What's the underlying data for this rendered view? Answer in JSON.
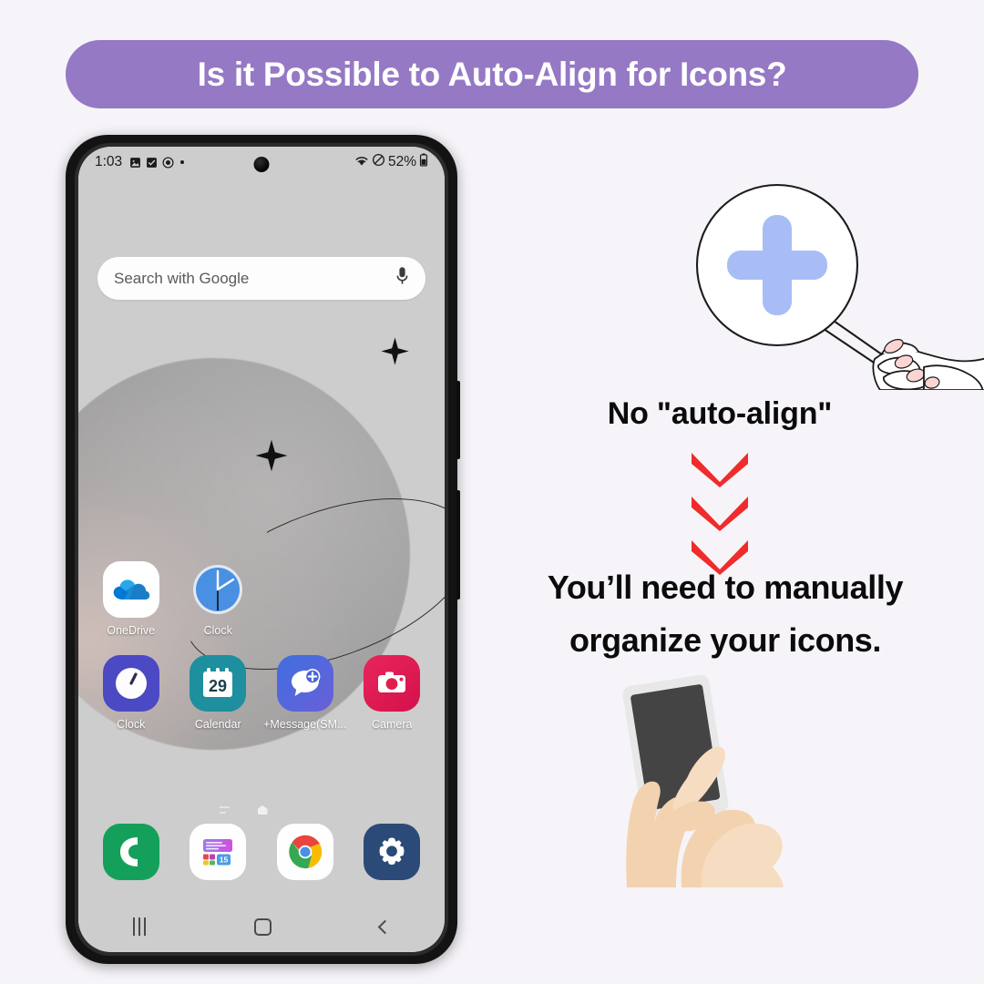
{
  "background_color": "#f6f4f8",
  "banner": {
    "title": "Is it Possible to Auto-Align for Icons?",
    "background_color": "#9579c4",
    "text_color": "#ffffff"
  },
  "phone": {
    "status_bar": {
      "time": "1:03",
      "left_icons": [
        "image-icon",
        "checkbox-icon",
        "capture-icon",
        "dot-icon"
      ],
      "right_icons": [
        "wifi-icon",
        "mute-icon"
      ],
      "battery_percent": "52%",
      "battery_icon": "battery-icon"
    },
    "search_bar": {
      "placeholder": "Search with Google",
      "mic_icon": "microphone-icon"
    },
    "wallpaper": {
      "description": "grey sphere with orbit ring",
      "sparkle_icons": [
        "sparkle-icon",
        "sparkle-icon"
      ]
    },
    "home_rows": [
      [
        {
          "label": "OneDrive",
          "icon": "onedrive-icon",
          "color": "#ffffff"
        },
        {
          "label": "Clock",
          "icon": "clock-icon",
          "color": "#4a90e2"
        }
      ],
      [
        {
          "label": "Clock",
          "icon": "clock-icon",
          "color": "#4b49c4"
        },
        {
          "label": "Calendar",
          "icon": "calendar-icon",
          "color": "#1d8f9e",
          "day": "29"
        },
        {
          "label": "+Message(SM...",
          "icon": "message-plus-icon",
          "color": "#4a63d8"
        },
        {
          "label": "Camera",
          "icon": "camera-icon",
          "color": "#e0204c"
        }
      ]
    ],
    "page_indicator": {
      "icons": [
        "menu-icon",
        "dot-icon",
        "home-page-icon",
        "dot-icon",
        "dot-icon"
      ],
      "active_index": 2,
      "total_pages": 4
    },
    "dock": [
      {
        "label": "",
        "icon": "phone-icon",
        "color": "#14a05a"
      },
      {
        "label": "",
        "icon": "widgets-icon",
        "color": "#ffffff",
        "badge": "15"
      },
      {
        "label": "",
        "icon": "chrome-icon",
        "color": "#ffffff"
      },
      {
        "label": "",
        "icon": "settings-gear-icon",
        "color": "#2c4a78"
      }
    ],
    "nav_bar": {
      "recents": "recents-icon",
      "home": "home-icon",
      "back": "back-icon"
    }
  },
  "right": {
    "magnifier_icon": "magnifier-plus-icon",
    "hand_icon": "hand-holding-magnifier-icon",
    "headline": "No \"auto-align\"",
    "arrows_icon": "chevron-down-icon",
    "arrows_count": 3,
    "arrows_color": "#ef2b2b",
    "sub_headline_line1": "You’ll need to manually",
    "sub_headline_line2": "organize your icons.",
    "hand_phone_icon": "hand-tapping-phone-icon"
  }
}
